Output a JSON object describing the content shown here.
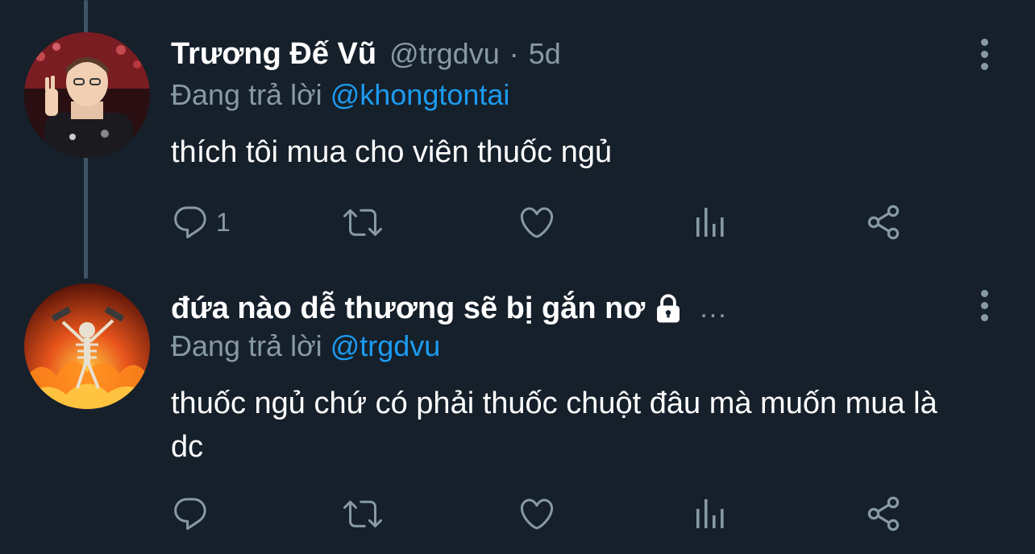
{
  "tweets": [
    {
      "display_name": "Trương Đế Vũ",
      "handle": "@trgdvu",
      "separator": "·",
      "time": "5d",
      "replying_prefix": "Đang trả lời",
      "replying_to": "@khongtontai",
      "text": "thích tôi mua cho viên thuốc ngủ",
      "reply_count": "1",
      "retweet_count": "",
      "like_count": ""
    },
    {
      "display_name": "đứa nào dễ thương sẽ bị gắn nơ",
      "truncation": "...",
      "protected_icon": "lock-icon",
      "replying_prefix": "Đang trả lời",
      "replying_to": "@trgdvu",
      "text": "thuốc ngủ chứ có phải thuốc chuột đâu mà muốn mua là dc",
      "reply_count": "",
      "retweet_count": "",
      "like_count": ""
    }
  ],
  "icons": {
    "reply": "speech-bubble-icon",
    "retweet": "retweet-icon",
    "like": "heart-icon",
    "analytics": "bar-chart-icon",
    "share": "share-icon",
    "more": "vertical-dots-icon"
  },
  "colors": {
    "background": "#15202b",
    "text": "#ffffff",
    "muted": "#8899a6",
    "link": "#1d9bf0",
    "thread_line": "#3d5466"
  }
}
